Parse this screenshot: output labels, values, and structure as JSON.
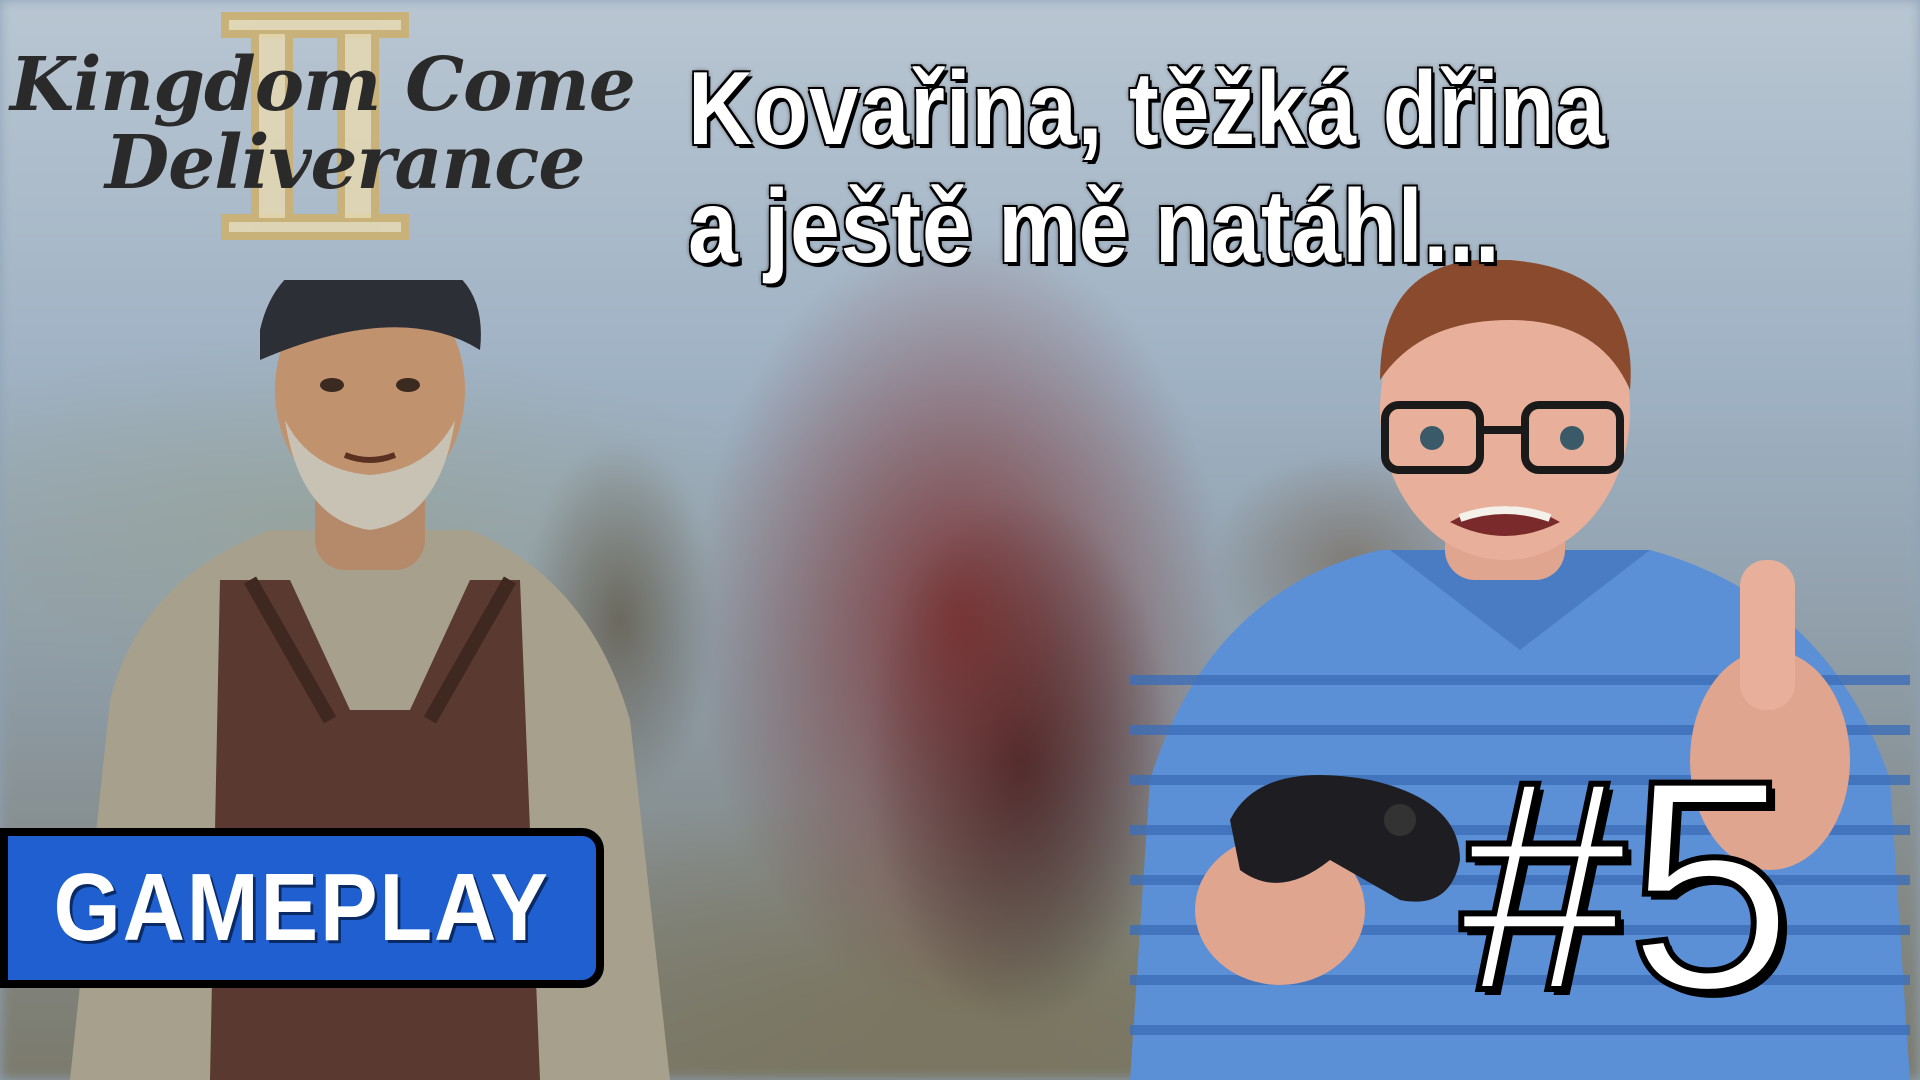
{
  "logo": {
    "line1": "Kingdom Come",
    "line2": "Deliverance",
    "numeral": "II"
  },
  "headline": {
    "line1": "Kovařina, těžká dřina",
    "line2": "a ještě mě natáhl..."
  },
  "badge": {
    "label": "GAMEPLAY"
  },
  "episode": {
    "label": "#5"
  },
  "colors": {
    "badge_fill": "#1f5fcf",
    "badge_border": "#000000",
    "headline_text": "#ffffff",
    "episode_text": "#ffffff"
  }
}
